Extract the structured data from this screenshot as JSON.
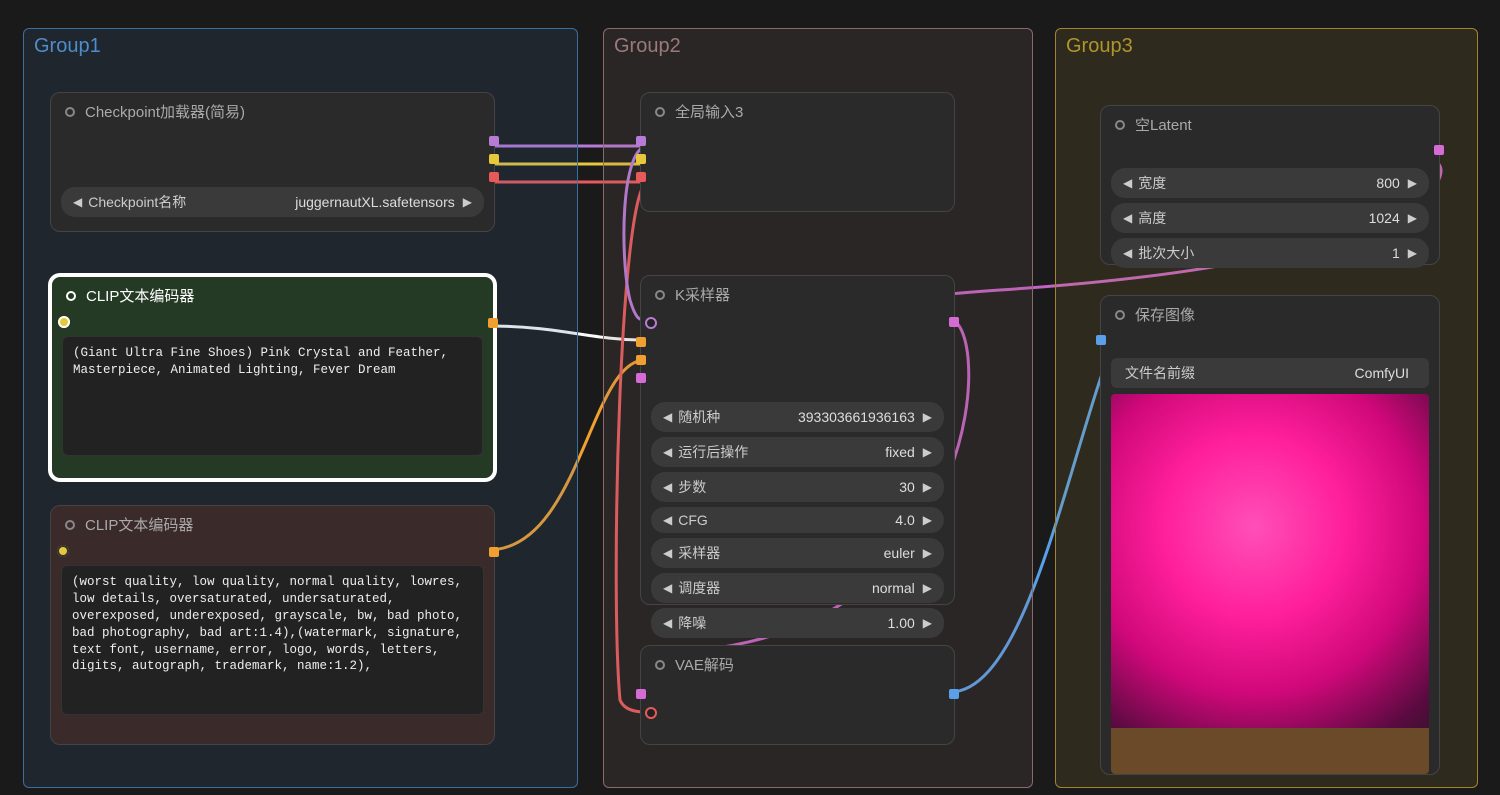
{
  "groups": {
    "g1": "Group1",
    "g2": "Group2",
    "g3": "Group3"
  },
  "nodes": {
    "ckpt": {
      "title": "Checkpoint加载器(简易)",
      "field_label": "Checkpoint名称",
      "field_value": "juggernautXL.safetensors"
    },
    "clip_pos": {
      "title": "CLIP文本编码器",
      "text": "(Giant Ultra Fine Shoes) Pink Crystal and Feather, Masterpiece, Animated Lighting, Fever Dream"
    },
    "clip_neg": {
      "title": "CLIP文本编码器",
      "text": "(worst quality, low quality, normal quality, lowres, low details, oversaturated, undersaturated, overexposed, underexposed, grayscale, bw, bad photo, bad photography, bad art:1.4),(watermark, signature, text font, username, error, logo, words, letters, digits, autograph, trademark, name:1.2),"
    },
    "global_in": {
      "title": "全局输入3"
    },
    "ksampler": {
      "title": "K采样器",
      "seed_label": "随机种",
      "seed_value": "393303661936163",
      "after_label": "运行后操作",
      "after_value": "fixed",
      "steps_label": "步数",
      "steps_value": "30",
      "cfg_label": "CFG",
      "cfg_value": "4.0",
      "sampler_label": "采样器",
      "sampler_value": "euler",
      "scheduler_label": "调度器",
      "scheduler_value": "normal",
      "denoise_label": "降噪",
      "denoise_value": "1.00"
    },
    "vae": {
      "title": "VAE解码"
    },
    "latent": {
      "title": "空Latent",
      "width_label": "宽度",
      "width_value": "800",
      "height_label": "高度",
      "height_value": "1024",
      "batch_label": "批次大小",
      "batch_value": "1"
    },
    "save": {
      "title": "保存图像",
      "prefix_label": "文件名前缀",
      "prefix_value": "ComfyUI"
    }
  }
}
